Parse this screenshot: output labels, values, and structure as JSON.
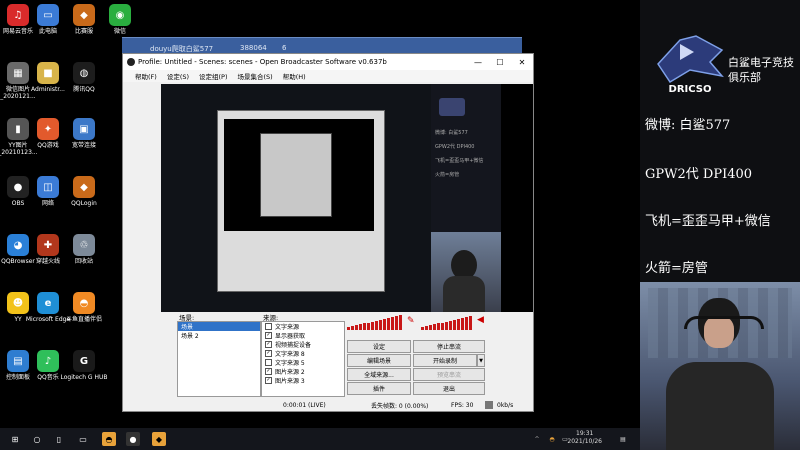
{
  "desktop_icons": [
    {
      "label": "网易云音乐",
      "icon": "netease-cloud-music-icon",
      "color": "#d92b2b",
      "sym": "♫"
    },
    {
      "label": "此电脑",
      "icon": "this-pc-icon",
      "color": "#3b7bd6",
      "sym": "▭"
    },
    {
      "label": "比赛服",
      "icon": "game-server-icon",
      "color": "#c96a1a",
      "sym": "◆"
    },
    {
      "label": "微信",
      "icon": "wechat-icon",
      "color": "#2aae3f",
      "sym": "◉"
    },
    {
      "label": "微信图片_2020121...",
      "icon": "image-file-icon",
      "color": "#6a6a6a",
      "sym": "▦"
    },
    {
      "label": "Administr...",
      "icon": "user-folder-icon",
      "color": "#d8b44a",
      "sym": "■"
    },
    {
      "label": "腾讯QQ",
      "icon": "qq-icon",
      "color": "#1d1d1d",
      "sym": "◍"
    },
    {
      "label": "YY图片_20210123...",
      "icon": "image-file-icon",
      "color": "#555",
      "sym": "▮"
    },
    {
      "label": "QQ游戏",
      "icon": "qq-game-icon",
      "color": "#e25a2c",
      "sym": "✦"
    },
    {
      "label": "宽带连接",
      "icon": "network-connection-icon",
      "color": "#3c78c8",
      "sym": "▣"
    },
    {
      "label": "OBS",
      "icon": "obs-icon",
      "color": "#222",
      "sym": "●"
    },
    {
      "label": "网络",
      "icon": "network-icon",
      "color": "#3b7bd6",
      "sym": "◫"
    },
    {
      "label": "QQLogin",
      "icon": "qqlogin-icon",
      "color": "#c96a1a",
      "sym": "◆"
    },
    {
      "label": "QQBrowser",
      "icon": "qq-browser-icon",
      "color": "#2a80d8",
      "sym": "◕"
    },
    {
      "label": "穿越火线",
      "icon": "crossfire-icon",
      "color": "#b2371c",
      "sym": "✚"
    },
    {
      "label": "回收站",
      "icon": "recycle-bin-icon",
      "color": "#7d8a99",
      "sym": "♲"
    },
    {
      "label": "YY",
      "icon": "yy-icon",
      "color": "#f2c21a",
      "sym": "☻"
    },
    {
      "label": "Microsoft Edge",
      "icon": "edge-icon",
      "color": "#1f8fd6",
      "sym": "e"
    },
    {
      "label": "斗鱼直播伴侣",
      "icon": "douyu-icon",
      "color": "#f08a24",
      "sym": "◓"
    },
    {
      "label": "控制面板",
      "icon": "control-panel-icon",
      "color": "#2e7dd0",
      "sym": "▤"
    },
    {
      "label": "QQ音乐",
      "icon": "qq-music-icon",
      "color": "#2fbf5a",
      "sym": "♪"
    },
    {
      "label": "Logitech G HUB",
      "icon": "logitech-icon",
      "color": "#1a1a1a",
      "sym": "G"
    }
  ],
  "bg_window": {
    "title": "douyu爬取白鲨577",
    "count": "388064",
    "num": "6"
  },
  "obs": {
    "title": "Profile: Untitled - Scenes: scenes - Open Broadcaster Software v0.637b",
    "menus": [
      "帮助(F)",
      "设定(S)",
      "设定组(P)",
      "场景集合(S)",
      "帮助(H)"
    ],
    "scenes_label": "场景:",
    "scenes": [
      "场景",
      "场景 2"
    ],
    "sources_label": "来源:",
    "sources": [
      {
        "label": "文字来源",
        "checked": false
      },
      {
        "label": "显示器获取",
        "checked": true
      },
      {
        "label": "视频捕捉设备",
        "checked": true
      },
      {
        "label": "文字来源 8",
        "checked": true
      },
      {
        "label": "文字来源 5",
        "checked": false
      },
      {
        "label": "图片来源 2",
        "checked": true
      },
      {
        "label": "图片来源 3",
        "checked": true
      }
    ],
    "buttons": {
      "settings": "设定",
      "stop_stream": "停止串流",
      "edit_scene": "编辑场景",
      "start_record": "开始录制",
      "fullscreen": "全域来源...",
      "preview_stream": "预览串流",
      "plugins": "插件",
      "exit": "退出"
    },
    "status": {
      "time": "0:00:01 (LIVE)",
      "dropped": "丢失帧数: 0 (0.00%)",
      "fps": "FPS: 30",
      "bitrate": "0kb/s"
    }
  },
  "taskbar": {
    "time": "19:31",
    "date": "2021/10/26"
  },
  "right_panel": {
    "club_name": "白鲨电子竞技俱乐部",
    "logo_text": "DRICSO",
    "lines": [
      "微博: 白鲨577",
      "GPW2代 DPI400",
      "飞机=歪歪马甲+微信",
      "火箭=房管"
    ]
  }
}
